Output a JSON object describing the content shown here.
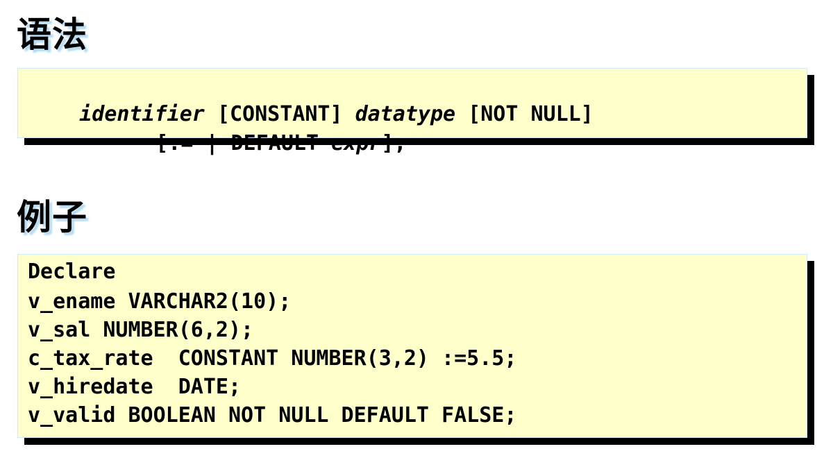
{
  "sections": {
    "syntax": {
      "heading": "语法",
      "line1": [
        {
          "text": "identifier",
          "italic": true
        },
        {
          "text": " [CONSTANT] ",
          "italic": false
        },
        {
          "text": "datatype",
          "italic": true
        },
        {
          "text": " [NOT NULL]",
          "italic": false
        }
      ],
      "line2": [
        {
          "text": "[:= | DEFAULT ",
          "italic": false
        },
        {
          "text": "expr",
          "italic": true
        },
        {
          "text": "];",
          "italic": false
        }
      ]
    },
    "example": {
      "heading": "例子",
      "lines": [
        "Declare",
        "v_ename VARCHAR2(10);",
        "v_sal NUMBER(6,2);",
        "c_tax_rate  CONSTANT NUMBER(3,2) :=5.5;",
        "v_hiredate  DATE;",
        "v_valid BOOLEAN NOT NULL DEFAULT FALSE;"
      ]
    }
  },
  "colors": {
    "code_background": "#ffffcc",
    "box_border": "#cfeaf6",
    "box_shadow": "#000000",
    "heading_shadow": "#b8dcf2"
  }
}
